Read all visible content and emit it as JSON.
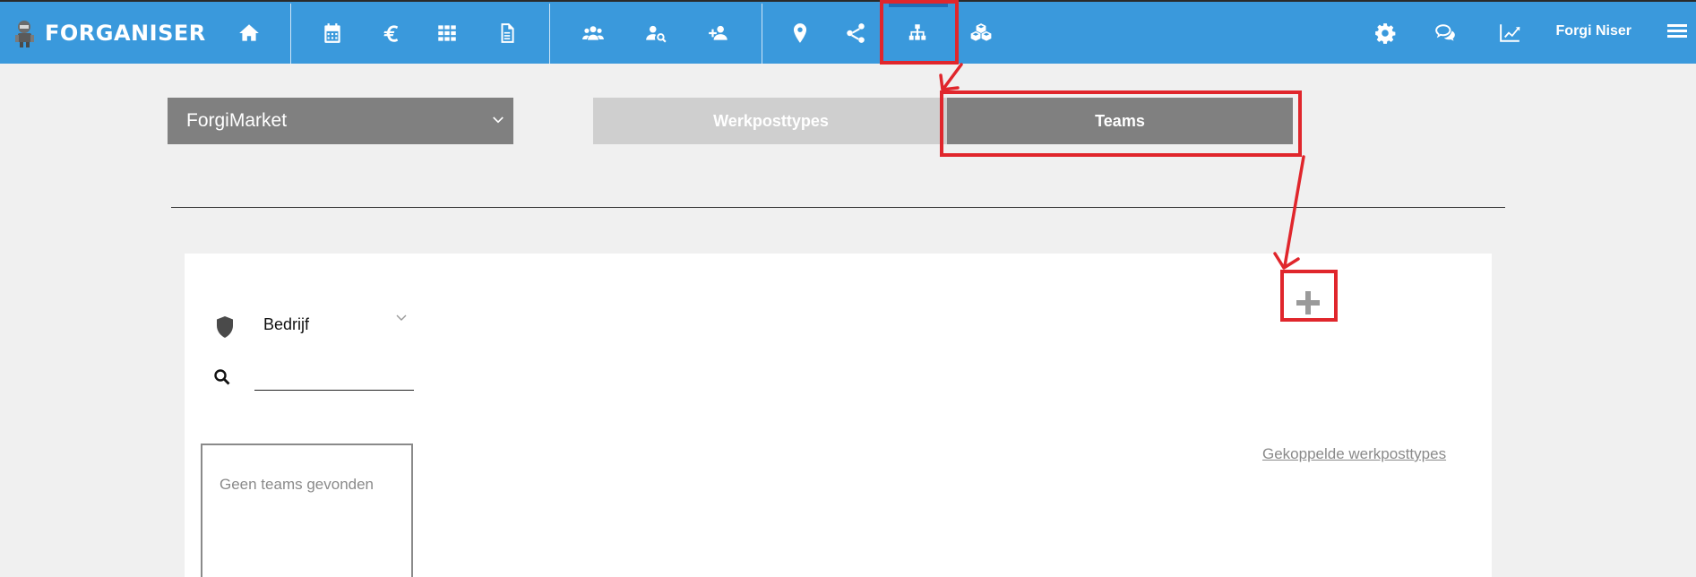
{
  "brand": {
    "name": "FORGANISER"
  },
  "header": {
    "icons": [
      "home-icon",
      "calendar-icon",
      "euro-icon",
      "grid-icon",
      "document-icon",
      "users-group-icon",
      "user-search-icon",
      "user-add-icon",
      "location-pin-icon",
      "share-icon",
      "org-chart-icon",
      "boxes-icon",
      "gear-icon",
      "chat-icon",
      "chart-line-icon"
    ],
    "user_name": "Forgi Niser"
  },
  "company_select": {
    "value": "ForgiMarket"
  },
  "tabs": [
    {
      "label": "Werkposttypes",
      "active": false
    },
    {
      "label": "Teams",
      "active": true
    }
  ],
  "panel": {
    "filter_label": "Bedrijf",
    "search_value": "",
    "empty_message": "Geen teams gevonden",
    "linked_link": "Gekoppelde werkposttypes"
  },
  "colors": {
    "topbar": "#3a99dc",
    "active_tab": "#808080",
    "inactive_tab": "#cfcfcf",
    "annotation": "#e0262c"
  }
}
